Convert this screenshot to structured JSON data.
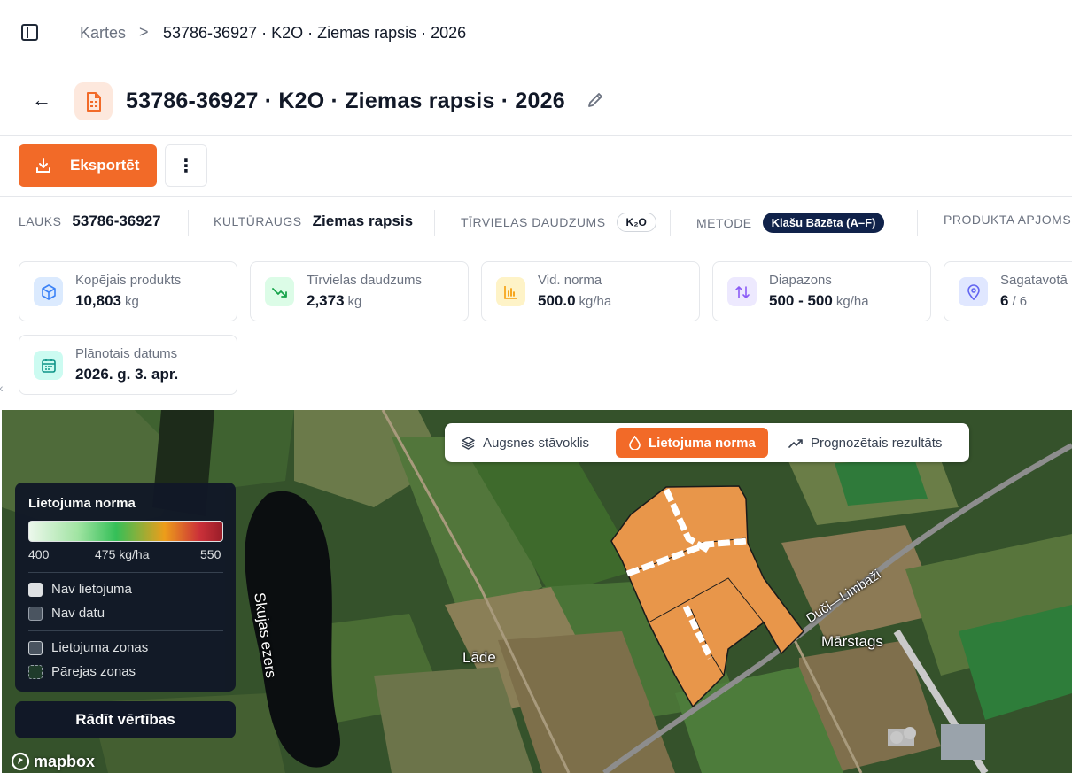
{
  "breadcrumb": {
    "root": "Kartes",
    "separator": ">",
    "current": "53786-36927 · K2O · Ziemas rapsis · 2026"
  },
  "header": {
    "title": "53786-36927 · K2O · Ziemas rapsis · 2026"
  },
  "actions": {
    "export_label": "Eksportēt",
    "more_label": "⋮"
  },
  "info": {
    "field_label": "LAUKS",
    "field_value": "53786-36927",
    "crop_label": "KULTŪRAUGS",
    "crop_value": "Ziemas rapsis",
    "nutrient_label": "TĪRVIELAS DAUDZUMS",
    "nutrient_chip": "K₂O",
    "method_label": "METODE",
    "method_chip": "Klašu Bāzēta (A–F)",
    "product_label": "PRODUKTA APJOMS"
  },
  "cards": [
    {
      "title": "Kopējais produkts",
      "value": "10,803",
      "unit": "kg",
      "icon": "box-icon",
      "color": "#3b82f6"
    },
    {
      "title": "Tīrvielas daudzums",
      "value": "2,373",
      "unit": "kg",
      "icon": "trending-down-icon",
      "color": "#16a34a"
    },
    {
      "title": "Vid. norma",
      "value": "500.0",
      "unit": "kg/ha",
      "icon": "bar-chart-icon",
      "color": "#f59e0b"
    },
    {
      "title": "Diapazons",
      "value": "500 - 500",
      "unit": "kg/ha",
      "icon": "arrows-up-down-icon",
      "color": "#8b5cf6"
    },
    {
      "title": "Sagatavotā",
      "value": "6",
      "unit": "/ 6",
      "icon": "map-pin-icon",
      "color": "#6366f1"
    },
    {
      "title": "Plānotais datums",
      "value": "2026. g. 3. apr.",
      "unit": "",
      "icon": "calendar-icon",
      "color": "#0d9488"
    }
  ],
  "map": {
    "tabs": [
      {
        "label": "Augsnes stāvoklis",
        "icon": "layers-icon",
        "active": false
      },
      {
        "label": "Lietojuma norma",
        "icon": "droplet-icon",
        "active": true
      },
      {
        "label": "Prognozētais rezultāts",
        "icon": "trending-up-icon",
        "active": false
      }
    ],
    "legend": {
      "title": "Lietojuma norma",
      "min": "400",
      "mid": "475 kg/ha",
      "max": "550",
      "items": [
        {
          "label": "Nav lietojuma",
          "color": "#e5e7eb"
        },
        {
          "label": "Nav datu",
          "color": "#4b5563"
        },
        {
          "label": "Lietojuma zonas",
          "color": "#4b5563"
        },
        {
          "label": "Pārejas zonas",
          "color": "#1f3b2c"
        }
      ]
    },
    "show_values_label": "Rādīt vērtības",
    "attribution": "mapbox",
    "places": {
      "lake": "Skujas ezers",
      "village": "Lāde",
      "town": "Mārstags",
      "road": "Duči—Limbaži"
    },
    "field_color": "#e8964a"
  }
}
